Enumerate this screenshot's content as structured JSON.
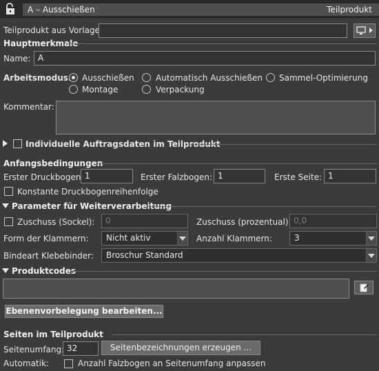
{
  "header": {
    "title": "A – Ausschießen",
    "type_label": "Teilprodukt"
  },
  "template": {
    "label": "Teilprodukt aus Vorlage:",
    "value": ""
  },
  "main_features": {
    "section_title": "Hauptmerkmale",
    "name_label": "Name:",
    "name_value": "A",
    "mode_label": "Arbeitsmodus:",
    "modes": {
      "ausschiessen": "Ausschießen",
      "auto": "Automatisch Ausschießen",
      "sammel": "Sammel-Optimierung",
      "montage": "Montage",
      "verpackung": "Verpackung"
    },
    "selected_mode": "Ausschießen",
    "comment_label": "Kommentar:",
    "comment_value": ""
  },
  "individual_order": {
    "label": "Individuelle Auftragsdaten im Teilprodukt",
    "checked": false
  },
  "initial_conditions": {
    "section_title": "Anfangsbedingungen",
    "first_sheet_label": "Erster Druckbogen:",
    "first_sheet_value": "1",
    "first_fold_label": "Erster Falzbogen:",
    "first_fold_value": "1",
    "first_page_label": "Erste Seite:",
    "first_page_value": "1",
    "constant_order_label": "Konstante Druckbogenreihenfolge",
    "constant_order_checked": false
  },
  "postpress": {
    "section_title": "Parameter für Weiterverarbeitung",
    "allowance_base_label": "Zuschuss (Sockel):",
    "allowance_base_value": "0",
    "allowance_base_checked": false,
    "allowance_pct_label": "Zuschuss (prozentual):",
    "allowance_pct_value": "0,0",
    "clamp_form_label": "Form der Klammern:",
    "clamp_form_value": "Nicht aktiv",
    "clamp_count_label": "Anzahl Klammern:",
    "clamp_count_value": "3",
    "binding_label": "Bindeart Klebebinder:",
    "binding_value": "Broschur Standard"
  },
  "product_codes": {
    "section_title": "Produktcodes",
    "value": "",
    "layer_button": "Ebenenvorbelegung bearbeiten..."
  },
  "pages": {
    "section_title": "Seiten im Teilprodukt",
    "count_label": "Seitenumfang:",
    "count_value": "32",
    "generate_button": "Seitenbezeichnungen erzeugen ...",
    "automatic_label": "Automatik:",
    "auto_fold_label": "Anzahl Falzbogen an Seitenumfang anpassen",
    "auto_fold_checked": false
  }
}
